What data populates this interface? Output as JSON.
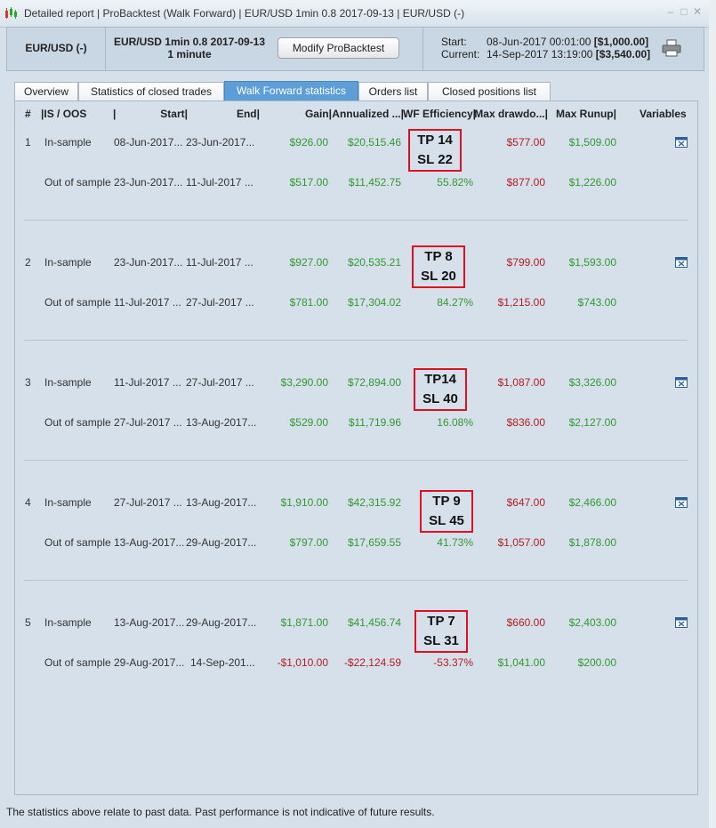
{
  "window": {
    "title": "Detailed report | ProBacktest (Walk Forward) | EUR/USD 1min 0.8 2017-09-13 | EUR/USD (-)"
  },
  "header": {
    "pair": "EUR/USD (-)",
    "symbol": "EUR/USD 1min 0.8 2017-09-13",
    "timeframe": "1 minute",
    "modify_button": "Modify ProBacktest",
    "start_label": "Start:",
    "start_value": "08-Jun-2017 00:01:00",
    "start_amount": "[$1,000.00]",
    "current_label": "Current:",
    "current_value": "14-Sep-2017 13:19:00",
    "current_amount": "[$3,540.00]"
  },
  "tabs": [
    {
      "label": "Overview"
    },
    {
      "label": "Statistics of closed trades"
    },
    {
      "label": "Walk Forward statistics"
    },
    {
      "label": "Orders list"
    },
    {
      "label": "Closed positions list"
    }
  ],
  "columns": {
    "num": "#",
    "isoos": "|IS / OOS",
    "sep": "|",
    "start": "Start|",
    "end": "End|",
    "gain": "Gain|",
    "annualized": "Annualized ...|",
    "wf": "WF Efficiency|",
    "maxdd": "Max drawdo...|",
    "maxru": "Max Runup|",
    "variables": "Variables"
  },
  "rows": [
    {
      "num": "1",
      "tp": "TP 14",
      "sl": "SL 22",
      "is": {
        "label": "In-sample",
        "start": "08-Jun-2017...",
        "end": "23-Jun-2017...",
        "gain": "$926.00",
        "annualized": "$20,515.46",
        "maxdd": "$577.00",
        "maxru": "$1,509.00"
      },
      "oos": {
        "label": "Out of sample",
        "start": "23-Jun-2017...",
        "end": "11-Jul-2017 ...",
        "gain": "$517.00",
        "annualized": "$11,452.75",
        "wf": "55.82%",
        "maxdd": "$877.00",
        "maxru": "$1,226.00"
      }
    },
    {
      "num": "2",
      "tp": "TP 8",
      "sl": "SL 20",
      "is": {
        "label": "In-sample",
        "start": "23-Jun-2017...",
        "end": "11-Jul-2017 ...",
        "gain": "$927.00",
        "annualized": "$20,535.21",
        "maxdd": "$799.00",
        "maxru": "$1,593.00"
      },
      "oos": {
        "label": "Out of sample",
        "start": "11-Jul-2017 ...",
        "end": "27-Jul-2017 ...",
        "gain": "$781.00",
        "annualized": "$17,304.02",
        "wf": "84.27%",
        "maxdd": "$1,215.00",
        "maxru": "$743.00"
      }
    },
    {
      "num": "3",
      "tp": "TP14",
      "sl": "SL 40",
      "is": {
        "label": "In-sample",
        "start": "11-Jul-2017 ...",
        "end": "27-Jul-2017 ...",
        "gain": "$3,290.00",
        "annualized": "$72,894.00",
        "maxdd": "$1,087.00",
        "maxru": "$3,326.00"
      },
      "oos": {
        "label": "Out of sample",
        "start": "27-Jul-2017 ...",
        "end": "13-Aug-2017...",
        "gain": "$529.00",
        "annualized": "$11,719.96",
        "wf": "16.08%",
        "maxdd": "$836.00",
        "maxru": "$2,127.00"
      }
    },
    {
      "num": "4",
      "tp": "TP 9",
      "sl": "SL 45",
      "is": {
        "label": "In-sample",
        "start": "27-Jul-2017 ...",
        "end": "13-Aug-2017...",
        "gain": "$1,910.00",
        "annualized": "$42,315.92",
        "maxdd": "$647.00",
        "maxru": "$2,466.00"
      },
      "oos": {
        "label": "Out of sample",
        "start": "13-Aug-2017...",
        "end": "29-Aug-2017...",
        "gain": "$797.00",
        "annualized": "$17,659.55",
        "wf": "41.73%",
        "maxdd": "$1,057.00",
        "maxru": "$1,878.00"
      }
    },
    {
      "num": "5",
      "tp": "TP 7",
      "sl": "SL 31",
      "is": {
        "label": "In-sample",
        "start": "13-Aug-2017...",
        "end": "29-Aug-2017...",
        "gain": "$1,871.00",
        "annualized": "$41,456.74",
        "maxdd": "$660.00",
        "maxru": "$2,403.00"
      },
      "oos": {
        "label": "Out of sample",
        "start": "29-Aug-2017...",
        "end": "14-Sep-201...",
        "gain": "-$1,010.00",
        "annualized": "-$22,124.59",
        "wf": "-53.37%",
        "maxdd": "$1,041.00",
        "maxru": "$200.00"
      }
    }
  ],
  "footer": "The statistics above relate to past data. Past performance is not indicative of future results.",
  "colors": {
    "positive": "#2e9b2e",
    "negative": "#b51e1e",
    "active_tab": "#5d9ed8",
    "highlight_box": "#e01020"
  }
}
